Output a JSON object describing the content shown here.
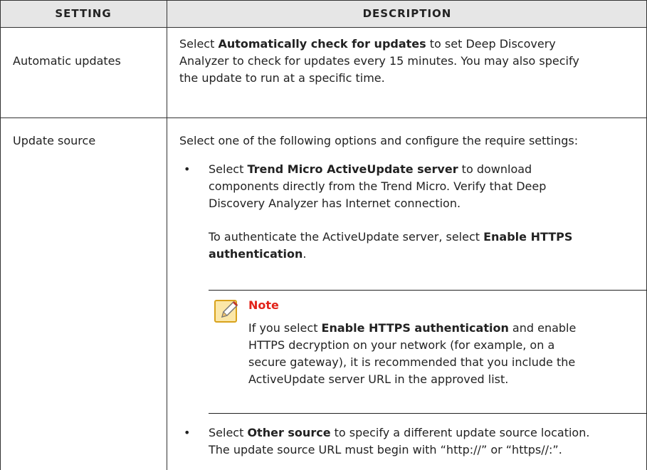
{
  "table": {
    "headers": [
      "Setting",
      "Description"
    ],
    "rows": [
      {
        "setting": "Automatic updates",
        "desc_1": "Select ",
        "desc_bold": "Automatically check for updates",
        "desc_2": " to set Deep Discovery",
        "desc_line2": "Analyzer to check for updates every 15 minutes. You may also specify",
        "desc_line3": "the update to run at a specific time."
      },
      {
        "setting": "Update source",
        "intro": "Select one of the following options and configure the require settings:",
        "bullet1": {
          "pre": "Select ",
          "bold": "Trend Micro ActiveUpdate server",
          "post": " to download",
          "line2": "components directly from the Trend Micro. Verify that Deep",
          "line3": "Discovery Analyzer has Internet connection."
        },
        "auth": {
          "pre": "To authenticate the ActiveUpdate server, select ",
          "bold1": "Enable HTTPS",
          "bold2": "authentication",
          "post": "."
        },
        "note": {
          "title": "Note",
          "line1_pre": "If you select ",
          "line1_bold": "Enable HTTPS authentication",
          "line1_post": " and enable",
          "line2": "HTTPS decryption on your network (for example, on a",
          "line3": "secure gateway), it is recommended that you include the",
          "line4": "ActiveUpdate server URL in the approved list."
        },
        "bullet2": {
          "pre": "Select ",
          "bold": "Other source",
          "post": " to specify a different update source location.",
          "line2": "The update source URL must begin with “http://” or “https//:”."
        }
      }
    ]
  },
  "colors": {
    "header_bg": "#e6e6e6",
    "note_title": "#e2231a",
    "border": "#333333"
  },
  "icons": {
    "note": "note-pencil-icon",
    "bullet": "bullet"
  }
}
